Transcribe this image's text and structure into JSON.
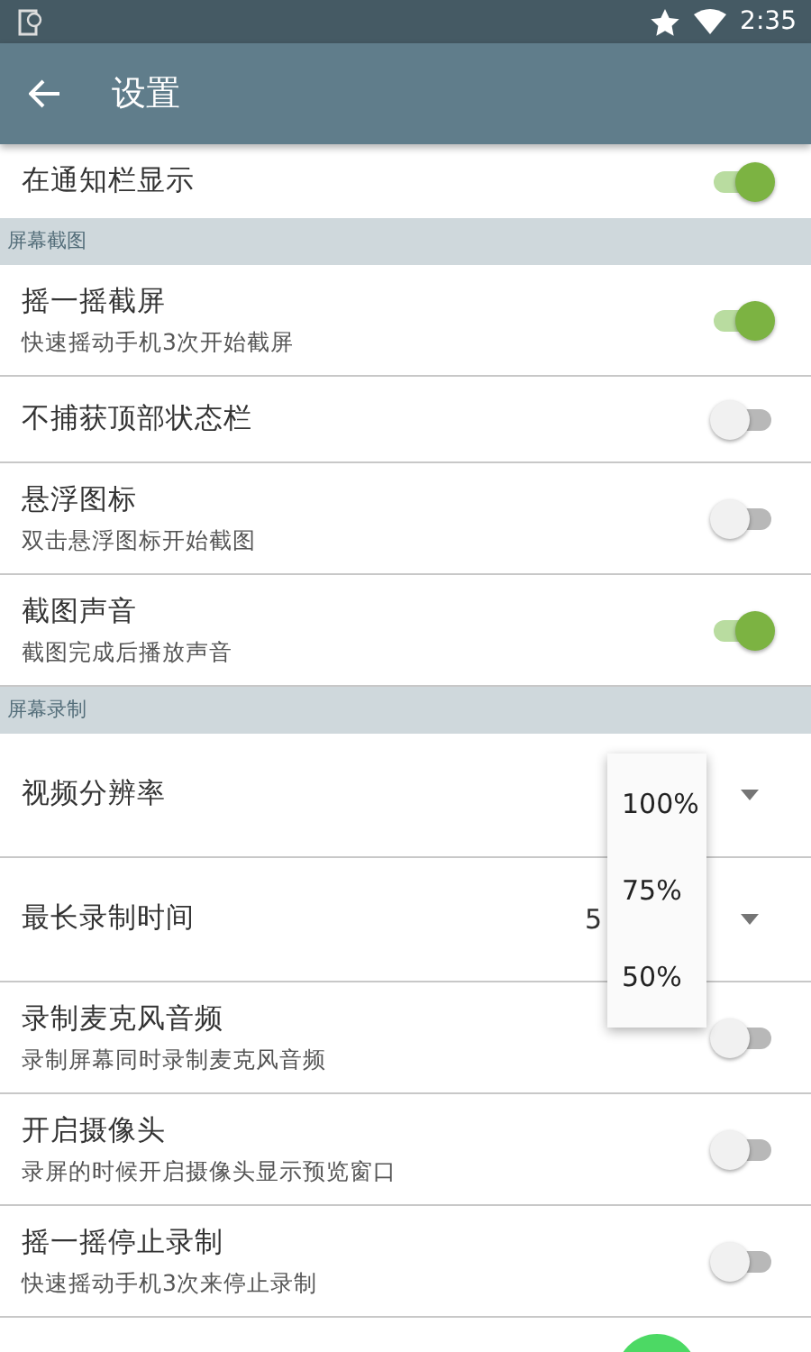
{
  "status_bar": {
    "time": "2:35"
  },
  "app_bar": {
    "title": "设置"
  },
  "items": [
    {
      "kind": "switch",
      "title": "在通知栏显示",
      "on": true
    },
    {
      "kind": "header",
      "title": "屏幕截图"
    },
    {
      "kind": "switch",
      "title": "摇一摇截屏",
      "subtitle": "快速摇动手机3次开始截屏",
      "on": true
    },
    {
      "kind": "switch",
      "title": "不捕获顶部状态栏",
      "on": false
    },
    {
      "kind": "switch",
      "title": "悬浮图标",
      "subtitle": "双击悬浮图标开始截图",
      "on": false
    },
    {
      "kind": "switch",
      "title": "截图声音",
      "subtitle": "截图完成后播放声音",
      "on": true
    },
    {
      "kind": "header",
      "title": "屏幕录制"
    },
    {
      "kind": "spinner",
      "title": "视频分辨率",
      "expanded": true,
      "options": [
        "100%",
        "75%",
        "50%"
      ]
    },
    {
      "kind": "spinner",
      "title": "最长录制时间",
      "value": "5"
    },
    {
      "kind": "switch",
      "title": "录制麦克风音频",
      "subtitle": "录制屏幕同时录制麦克风音频",
      "on": false
    },
    {
      "kind": "switch",
      "title": "开启摄像头",
      "subtitle": "录屏的时候开启摄像头显示预览窗口",
      "on": false
    },
    {
      "kind": "switch",
      "title": "摇一摇停止录制",
      "subtitle": "快速摇动手机3次来停止录制",
      "on": false
    }
  ]
}
